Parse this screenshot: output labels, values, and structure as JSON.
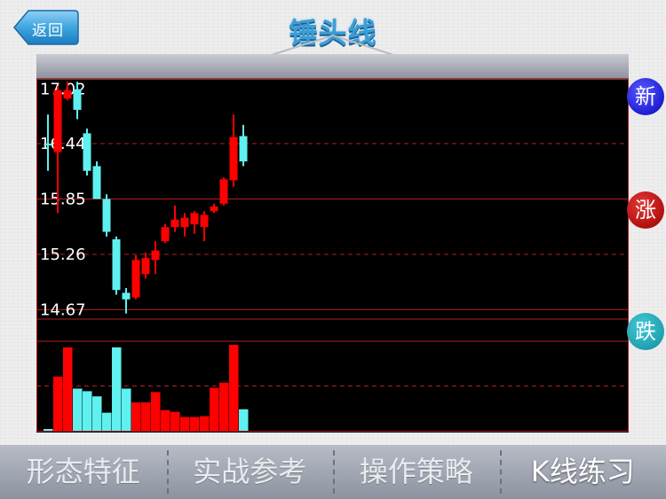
{
  "header": {
    "back_label": "返回",
    "title": "锤头线"
  },
  "side_buttons": {
    "new_label": "新",
    "up_label": "涨",
    "down_label": "跌"
  },
  "tabs": [
    {
      "label": "形态特征"
    },
    {
      "label": "实战参考"
    },
    {
      "label": "操作策略"
    },
    {
      "label": "K线练习",
      "active": true
    }
  ],
  "colors": {
    "up": "#ff0000",
    "down": "#5ff0f0",
    "grid": "#b02020",
    "title": "#3d9ed6"
  },
  "chart_data": {
    "type": "candlestick",
    "price_ticks": [
      "17.02",
      "16.44",
      "15.85",
      "15.26",
      "14.67"
    ],
    "ylim": [
      14.57,
      17.13
    ],
    "candles": [
      {
        "o": 16.44,
        "c": 16.44,
        "h": 16.75,
        "l": 16.15,
        "dir": "down"
      },
      {
        "o": 16.35,
        "c": 17.01,
        "h": 17.05,
        "l": 15.7,
        "dir": "up"
      },
      {
        "o": 16.92,
        "c": 17.01,
        "h": 17.1,
        "l": 16.9,
        "dir": "up"
      },
      {
        "o": 17.02,
        "c": 16.8,
        "h": 17.1,
        "l": 16.7,
        "dir": "down"
      },
      {
        "o": 16.55,
        "c": 16.15,
        "h": 16.6,
        "l": 16.1,
        "dir": "down"
      },
      {
        "o": 16.2,
        "c": 15.85,
        "h": 16.25,
        "l": 15.85,
        "dir": "down"
      },
      {
        "o": 15.85,
        "c": 15.5,
        "h": 15.9,
        "l": 15.45,
        "dir": "down"
      },
      {
        "o": 15.42,
        "c": 14.88,
        "h": 15.45,
        "l": 14.83,
        "dir": "down"
      },
      {
        "o": 14.85,
        "c": 14.78,
        "h": 14.9,
        "l": 14.63,
        "dir": "down"
      },
      {
        "o": 14.8,
        "c": 15.2,
        "h": 15.25,
        "l": 14.78,
        "dir": "up"
      },
      {
        "o": 15.05,
        "c": 15.22,
        "h": 15.28,
        "l": 15.0,
        "dir": "up"
      },
      {
        "o": 15.2,
        "c": 15.3,
        "h": 15.4,
        "l": 15.05,
        "dir": "up"
      },
      {
        "o": 15.4,
        "c": 15.55,
        "h": 15.58,
        "l": 15.38,
        "dir": "up"
      },
      {
        "o": 15.55,
        "c": 15.63,
        "h": 15.78,
        "l": 15.5,
        "dir": "up"
      },
      {
        "o": 15.55,
        "c": 15.65,
        "h": 15.7,
        "l": 15.45,
        "dir": "up"
      },
      {
        "o": 15.58,
        "c": 15.7,
        "h": 15.72,
        "l": 15.48,
        "dir": "up"
      },
      {
        "o": 15.55,
        "c": 15.68,
        "h": 15.72,
        "l": 15.4,
        "dir": "up"
      },
      {
        "o": 15.72,
        "c": 15.77,
        "h": 15.8,
        "l": 15.7,
        "dir": "up"
      },
      {
        "o": 15.8,
        "c": 16.06,
        "h": 16.08,
        "l": 15.78,
        "dir": "up"
      },
      {
        "o": 16.05,
        "c": 16.51,
        "h": 16.75,
        "l": 15.98,
        "dir": "up"
      },
      {
        "o": 16.25,
        "c": 16.52,
        "h": 16.64,
        "l": 16.2,
        "dir": "down"
      }
    ],
    "volumes": [
      0.02,
      0.63,
      0.97,
      0.49,
      0.46,
      0.4,
      0.21,
      0.97,
      0.49,
      0.33,
      0.33,
      0.45,
      0.24,
      0.22,
      0.16,
      0.16,
      0.17,
      0.5,
      0.56,
      1.0,
      0.25
    ]
  }
}
